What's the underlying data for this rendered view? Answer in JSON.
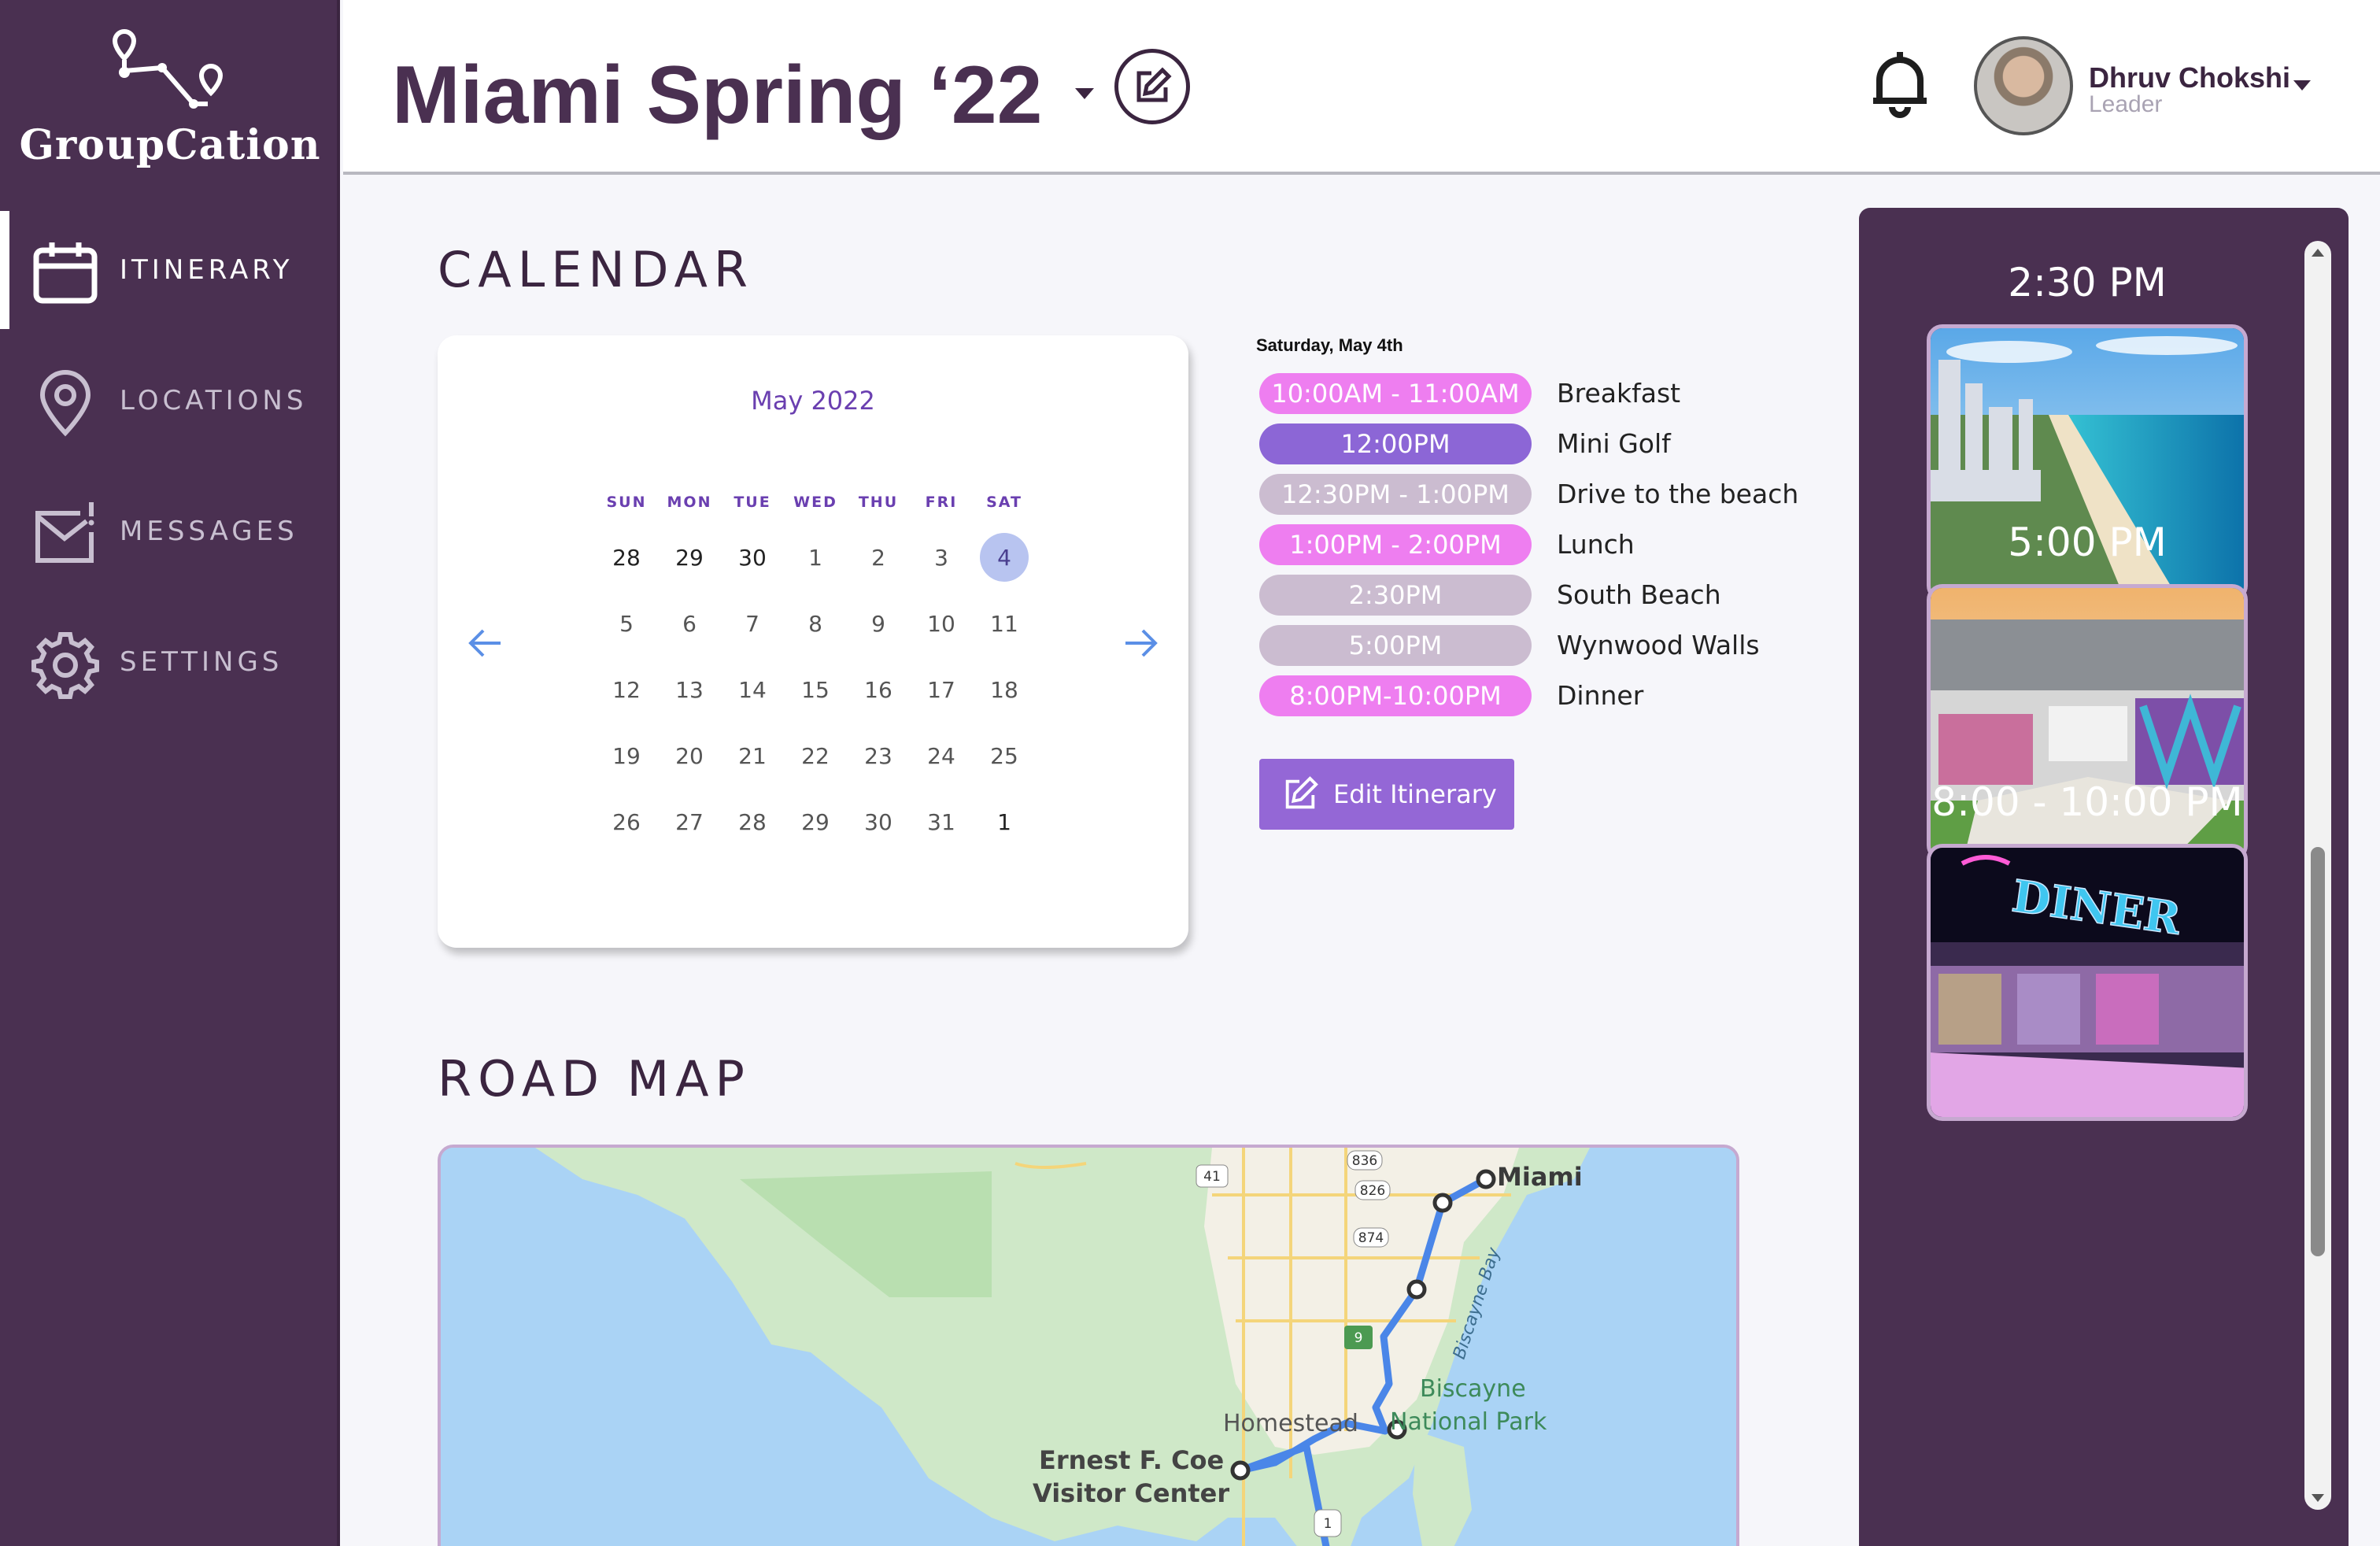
{
  "app": {
    "logo_text": "GroupCation"
  },
  "sidebar": {
    "items": [
      {
        "label": "ITINERARY",
        "icon": "calendar-icon",
        "active": true
      },
      {
        "label": "LOCATIONS",
        "icon": "location-pin-icon",
        "active": false
      },
      {
        "label": "MESSAGES",
        "icon": "mail-icon",
        "active": false
      },
      {
        "label": "SETTINGS",
        "icon": "gear-icon",
        "active": false
      }
    ]
  },
  "header": {
    "trip_title": "Miami Spring ‘22",
    "user": {
      "name": "Dhruv Chokshi",
      "role": "Leader"
    }
  },
  "calendar": {
    "section_title": "CALENDAR",
    "month": "May 2022",
    "weekdays": [
      "SUN",
      "MON",
      "TUE",
      "WED",
      "THU",
      "FRI",
      "SAT"
    ],
    "weeks": [
      [
        "28",
        "29",
        "30",
        "1",
        "2",
        "3",
        "4"
      ],
      [
        "5",
        "6",
        "7",
        "8",
        "9",
        "10",
        "11"
      ],
      [
        "12",
        "13",
        "14",
        "15",
        "16",
        "17",
        "18"
      ],
      [
        "19",
        "20",
        "21",
        "22",
        "23",
        "24",
        "25"
      ],
      [
        "26",
        "27",
        "28",
        "29",
        "30",
        "31",
        "1"
      ]
    ],
    "selected_day": "4"
  },
  "schedule": {
    "date": "Saturday, May 4th",
    "items": [
      {
        "time": "10:00AM - 11:00AM",
        "event": "Breakfast",
        "color": "#ee7ef0"
      },
      {
        "time": "12:00PM",
        "event": "Mini Golf",
        "color": "#8c66d6"
      },
      {
        "time": "12:30PM - 1:00PM",
        "event": "Drive to the beach",
        "color": "#cbbcd0"
      },
      {
        "time": "1:00PM - 2:00PM",
        "event": "Lunch",
        "color": "#ee7ef0"
      },
      {
        "time": "2:30PM",
        "event": "South Beach",
        "color": "#cbbcd0"
      },
      {
        "time": "5:00PM",
        "event": "Wynwood Walls",
        "color": "#cbbcd0"
      },
      {
        "time": "8:00PM-10:00PM",
        "event": "Dinner",
        "color": "#ee7ef0"
      }
    ],
    "edit_button": "Edit Itinerary"
  },
  "roadmap": {
    "section_title": "ROAD MAP",
    "labels": {
      "miami": "Miami",
      "homestead": "Homestead",
      "park_line1": "Biscayne",
      "park_line2": "National Park",
      "bay": "Biscayne Bay",
      "visitor_line1": "Ernest F. Coe",
      "visitor_line2": "Visitor Center"
    },
    "shields": [
      "836",
      "826",
      "874",
      "41",
      "1",
      "9"
    ]
  },
  "upcoming": {
    "items": [
      {
        "time": "2:30 PM"
      },
      {
        "time": "5:00 PM"
      },
      {
        "time": "8:00 - 10:00 PM",
        "sign": "DINER"
      }
    ]
  },
  "colors": {
    "sidebar_bg": "#4a3051",
    "accent_purple": "#9467d6",
    "pink_pill": "#ee7ef0",
    "muted_pill": "#cbbcd0"
  }
}
